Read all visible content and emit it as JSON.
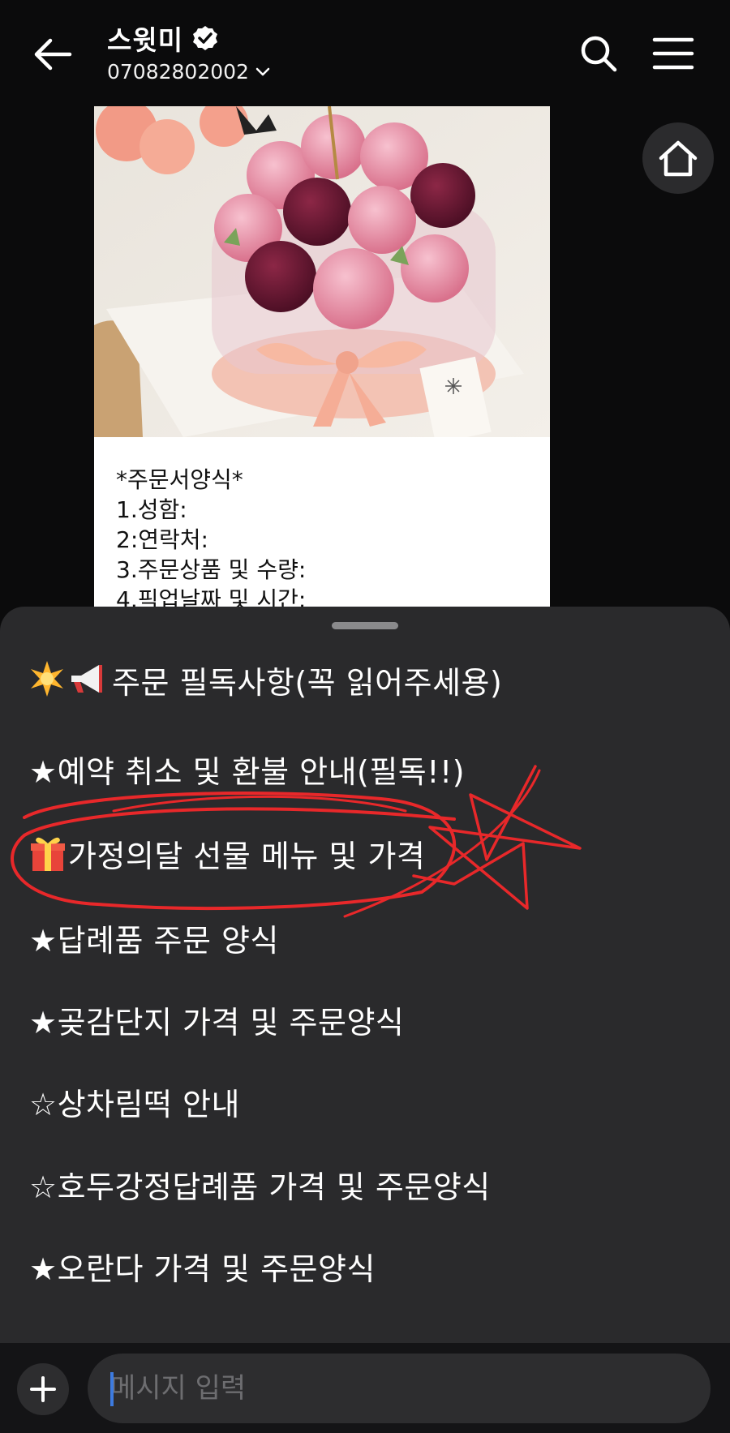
{
  "header": {
    "title": "스윗미",
    "phone": "07082802002",
    "icons": [
      "back-arrow-icon",
      "verified-badge-icon",
      "chevron-down-icon",
      "search-icon",
      "hamburger-menu-icon",
      "home-icon"
    ]
  },
  "message_card": {
    "photo_description_icon": "macaron-flower-cake-photo",
    "lines": [
      "*주문서양식*",
      "1.성함:",
      "2:연락처:",
      "3.주문상품 및 수량:",
      "4.픽업날짜 및 시간:"
    ]
  },
  "menu": {
    "items": [
      {
        "icon": "sparkle-megaphone-emoji",
        "label": "주문 필독사항(꼭 읽어주세용)"
      },
      {
        "icon": "",
        "label": "★예약 취소 및 환불 안내(필독!!)"
      },
      {
        "icon": "gift-emoji",
        "label": "가정의달 선물  메뉴 및 가격"
      },
      {
        "icon": "",
        "label": "★답례품 주문 양식"
      },
      {
        "icon": "",
        "label": "★곶감단지 가격 및 주문양식"
      },
      {
        "icon": "",
        "label": "☆상차림떡 안내"
      },
      {
        "icon": "",
        "label": "☆호두강정답례품 가격 및 주문양식"
      },
      {
        "icon": "",
        "label": "★오란다 가격 및 주문양식"
      }
    ]
  },
  "input_bar": {
    "placeholder": "메시지 입력"
  },
  "colors": {
    "background": "#0b0b0c",
    "sheet": "#2a2a2c",
    "annotation_red": "#e8282a",
    "caret_blue": "#3d7be0"
  }
}
